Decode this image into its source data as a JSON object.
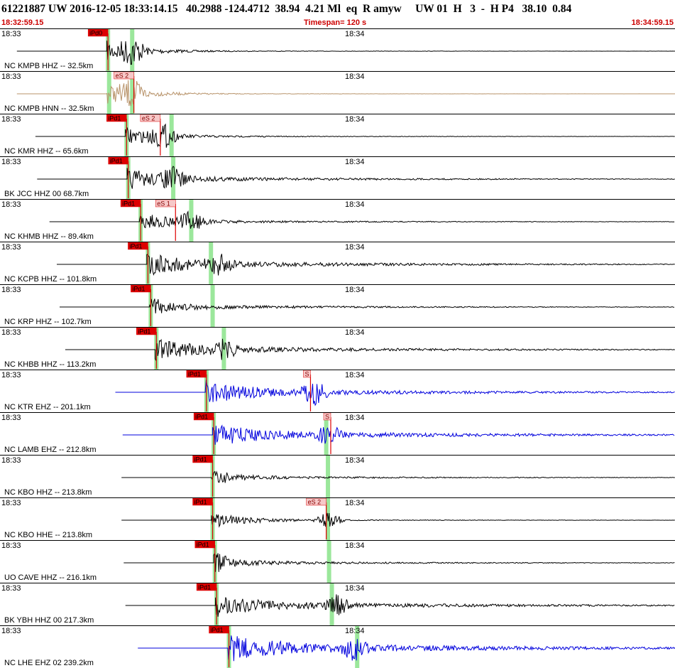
{
  "header": {
    "title": "61221887 UW 2016-12-05 18:33:14.15   40.2988 -124.4712  38.94  4.21 Ml  eq  R amyw     UW 01  H   3  -  H P4   38.10  0.84",
    "time_start": "18:32:59.15",
    "timespan": "Timespan= 120 s",
    "time_end": "18:34:59.15"
  },
  "minute_labels": {
    "left": "18:33",
    "mid": "18:34"
  },
  "colors": {
    "trace_default": "#000000",
    "trace_hnn": "#b8936a",
    "trace_ehz": "#0000dd",
    "pick": "#dd0000",
    "pick_window": "#9be79b"
  },
  "channels": [
    {
      "label": "NC KMPB HHZ -- 32.5km",
      "color": "black",
      "picks": [
        {
          "text": "iPd0",
          "t": 19.2
        }
      ],
      "green": [
        19.2,
        23.5
      ],
      "onset": 19.0,
      "amp": 1.0,
      "coda": 0.05,
      "spike": 23.5
    },
    {
      "label": "NC KMPB HNN -- 32.5km",
      "color": "tan",
      "picks": [
        {
          "text": "eS 2",
          "t": 23.8
        }
      ],
      "green": [
        19.4,
        23.5
      ],
      "onset": 19.0,
      "amp": 1.0,
      "coda": 0.03,
      "spike": 23.5
    },
    {
      "label": "NC KMR HHZ -- 65.6km",
      "color": "black",
      "picks": [
        {
          "text": "iPd1",
          "t": 22.5
        },
        {
          "text": "eS 2",
          "t": 28.5
        }
      ],
      "green": [
        22.5,
        30.5
      ],
      "onset": 22.3,
      "amp": 0.9,
      "coda": 0.08,
      "spike": 29.0
    },
    {
      "label": "BK JCC HHZ 00 68.7km",
      "color": "black",
      "picks": [
        {
          "text": "iPd1",
          "t": 22.8
        }
      ],
      "green": [
        22.8,
        30.8
      ],
      "onset": 22.6,
      "amp": 0.9,
      "coda": 0.25,
      "spike": 31.0
    },
    {
      "label": "NC KHMB HHZ -- 89.4km",
      "color": "black",
      "picks": [
        {
          "text": "iPd1",
          "t": 25.0
        },
        {
          "text": "eS 1",
          "t": 31.2
        }
      ],
      "green": [
        25.0,
        34.0
      ],
      "onset": 24.8,
      "amp": 0.8,
      "coda": 0.15,
      "spike": 34.0
    },
    {
      "label": "NC KCPB HHZ -- 101.8km",
      "color": "black",
      "picks": [
        {
          "text": "iPd1",
          "t": 26.3
        }
      ],
      "green": [
        26.3,
        37.5
      ],
      "onset": 26.1,
      "amp": 0.9,
      "coda": 0.35,
      "spike": 39.0
    },
    {
      "label": "NC KRP HHZ -- 102.7km",
      "color": "black",
      "picks": [
        {
          "text": "iPd1",
          "t": 26.8
        }
      ],
      "green": [
        26.8,
        37.8
      ],
      "onset": 26.6,
      "amp": 0.4,
      "coda": 0.2,
      "spike": 27.0
    },
    {
      "label": "NC KHBB HHZ -- 113.2km",
      "color": "black",
      "picks": [
        {
          "text": "iPd1",
          "t": 27.8
        }
      ],
      "green": [
        27.8,
        39.8
      ],
      "onset": 27.6,
      "amp": 0.8,
      "coda": 0.35,
      "spike": 40.0
    },
    {
      "label": "NC KTR EHZ -- 201.1km",
      "color": "blue",
      "picks": [
        {
          "text": "iPd1",
          "t": 36.7
        },
        {
          "text": "S",
          "t": 55.2
        }
      ],
      "green": [
        36.7
      ],
      "onset": 36.5,
      "amp": 1.0,
      "coda": 0.4,
      "spike": 56.0
    },
    {
      "label": "NC LAMB EHZ -- 212.8km",
      "color": "blue",
      "picks": [
        {
          "text": "iPd1",
          "t": 38.0
        },
        {
          "text": "S",
          "t": 58.8
        }
      ],
      "green": [
        38.0,
        58.0
      ],
      "onset": 37.8,
      "amp": 0.8,
      "coda": 0.45,
      "spike": 58.5
    },
    {
      "label": "NC KBO HHZ -- 213.8km",
      "color": "black",
      "picks": [
        {
          "text": "iPd1",
          "t": 37.8
        }
      ],
      "green": [
        37.8,
        58.3
      ],
      "onset": 37.6,
      "amp": 0.35,
      "coda": 0.15,
      "spike": 38.5
    },
    {
      "label": "NC KBO HHE -- 213.8km",
      "color": "black",
      "picks": [
        {
          "text": "iPd1",
          "t": 37.8
        },
        {
          "text": "eS 2",
          "t": 58.0
        }
      ],
      "green": [
        37.8,
        58.3
      ],
      "onset": 37.6,
      "amp": 0.7,
      "coda": 0.08,
      "spike": 58.5
    },
    {
      "label": "UO CAVE HHZ -- 216.1km",
      "color": "black",
      "picks": [
        {
          "text": "iPd1",
          "t": 38.2
        }
      ],
      "green": [
        38.2,
        58.5
      ],
      "onset": 38.0,
      "amp": 0.45,
      "coda": 0.15,
      "spike": 39.0
    },
    {
      "label": "BK YBH HHZ 00 217.3km",
      "color": "black",
      "picks": [
        {
          "text": "iPd1",
          "t": 38.5
        }
      ],
      "green": [
        38.5,
        59.0
      ],
      "onset": 38.3,
      "amp": 0.8,
      "coda": 0.4,
      "spike": 60.0
    },
    {
      "label": "NC LHE EHZ 02 239.2km",
      "color": "blue",
      "picks": [
        {
          "text": "iPd1",
          "t": 40.7
        }
      ],
      "green": [
        40.7,
        63.5
      ],
      "onset": 40.5,
      "amp": 0.9,
      "coda": 0.6,
      "spike": 63.0
    }
  ]
}
